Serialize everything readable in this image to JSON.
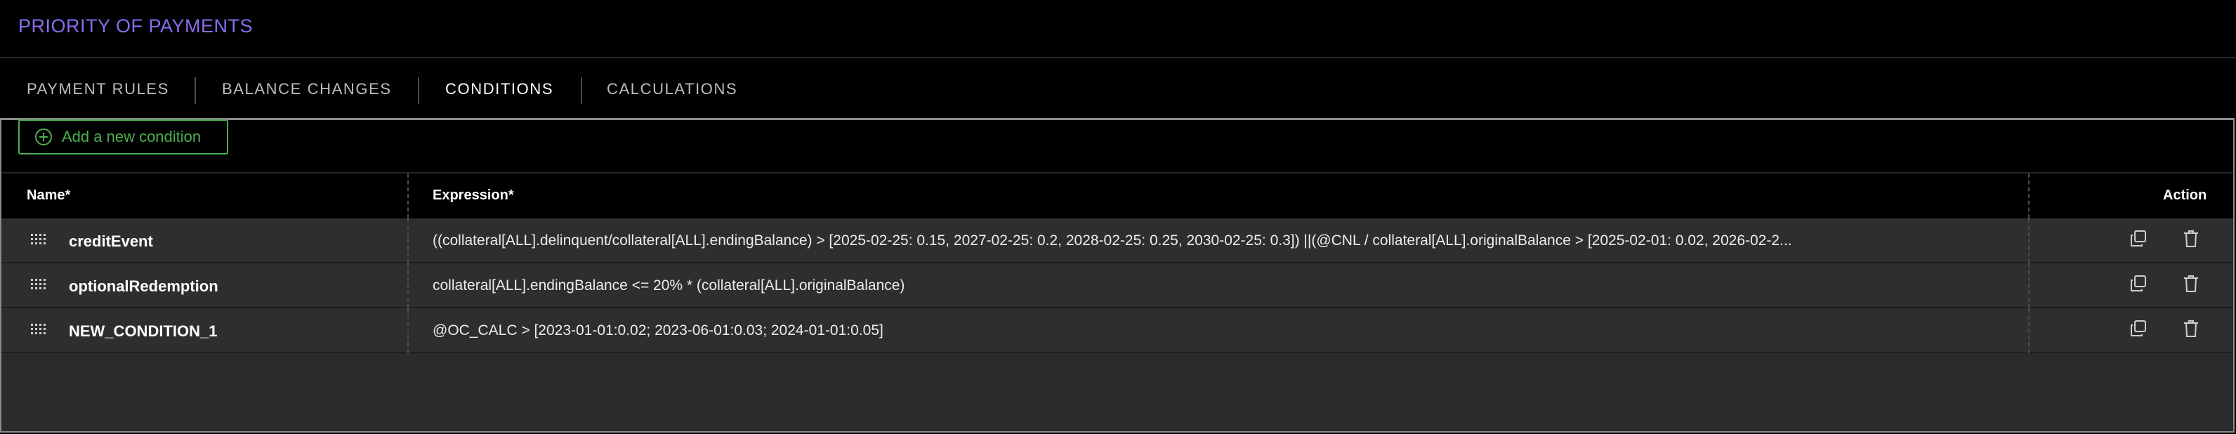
{
  "page": {
    "title": "PRIORITY OF PAYMENTS"
  },
  "tabs": [
    {
      "label": "PAYMENT RULES",
      "active": false
    },
    {
      "label": "BALANCE CHANGES",
      "active": false
    },
    {
      "label": "CONDITIONS",
      "active": true
    },
    {
      "label": "CALCULATIONS",
      "active": false
    }
  ],
  "toolbar": {
    "add_label": "Add a new condition"
  },
  "table": {
    "headers": {
      "name": "Name*",
      "expression": "Expression*",
      "action": "Action"
    },
    "rows": [
      {
        "name": "creditEvent",
        "expression": "((collateral[ALL].delinquent/collateral[ALL].endingBalance) > [2025-02-25: 0.15, 2027-02-25: 0.2, 2028-02-25: 0.25, 2030-02-25: 0.3]) ||(@CNL / collateral[ALL].originalBalance > [2025-02-01: 0.02, 2026-02-2..."
      },
      {
        "name": "optionalRedemption",
        "expression": "collateral[ALL].endingBalance <= 20% * (collateral[ALL].originalBalance)"
      },
      {
        "name": "NEW_CONDITION_1",
        "expression": "@OC_CALC > [2023-01-01:0.02; 2023-06-01:0.03; 2024-01-01:0.05]"
      }
    ]
  },
  "colors": {
    "title": "#8a6cf0",
    "accent_green": "#4caf50",
    "row_bg": "#2e2e2e",
    "background": "#000000"
  },
  "icons": {
    "drag": "drag-handle-icon",
    "copy": "copy-icon",
    "delete": "trash-icon",
    "add": "plus-circle-icon"
  }
}
